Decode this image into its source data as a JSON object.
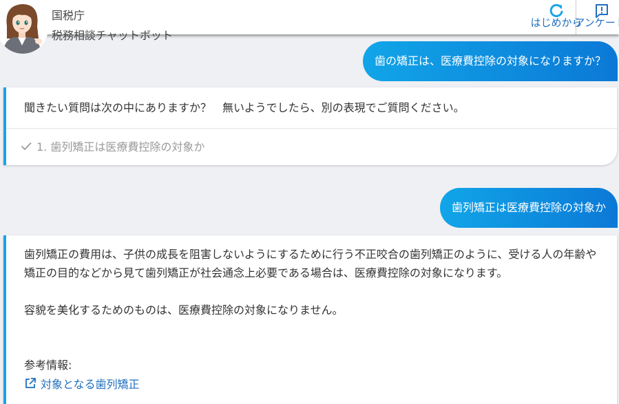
{
  "header": {
    "agency": "国税庁",
    "bot_name": "税務相談チャットボット",
    "restart_label": "はじめから",
    "survey_label": "アンケート"
  },
  "messages": {
    "user1": "歯の矯正は、医療費控除の対象になりますか？",
    "bot1": {
      "question": "聞きたい質問は次の中にありますか？　無いようでしたら、別の表現でご質問ください。",
      "option": "1. 歯列矯正は医療費控除の対象か"
    },
    "user2": "歯列矯正は医療費控除の対象か",
    "bot2": {
      "para1": "歯列矯正の費用は、子供の成長を阻害しないようにするために行う不正咬合の歯列矯正のように、受ける人の年齢や矯正の目的などから見て歯列矯正が社会通念上必要である場合は、医療費控除の対象になります。",
      "para2": "容貌を美化するためのものは、医療費控除の対象になりません。",
      "ref_label": "参考情報:",
      "ref_link": "対象となる歯列矯正"
    }
  },
  "colors": {
    "accent": "#1aa3ea",
    "bubble_start": "#11a5e8",
    "bubble_end": "#0b79d6",
    "link": "#1f6fbf",
    "background": "#eef0f4"
  },
  "icons": {
    "restart": "refresh-icon",
    "survey": "feedback-icon",
    "option_check": "check-icon",
    "external_link": "external-link-icon"
  }
}
